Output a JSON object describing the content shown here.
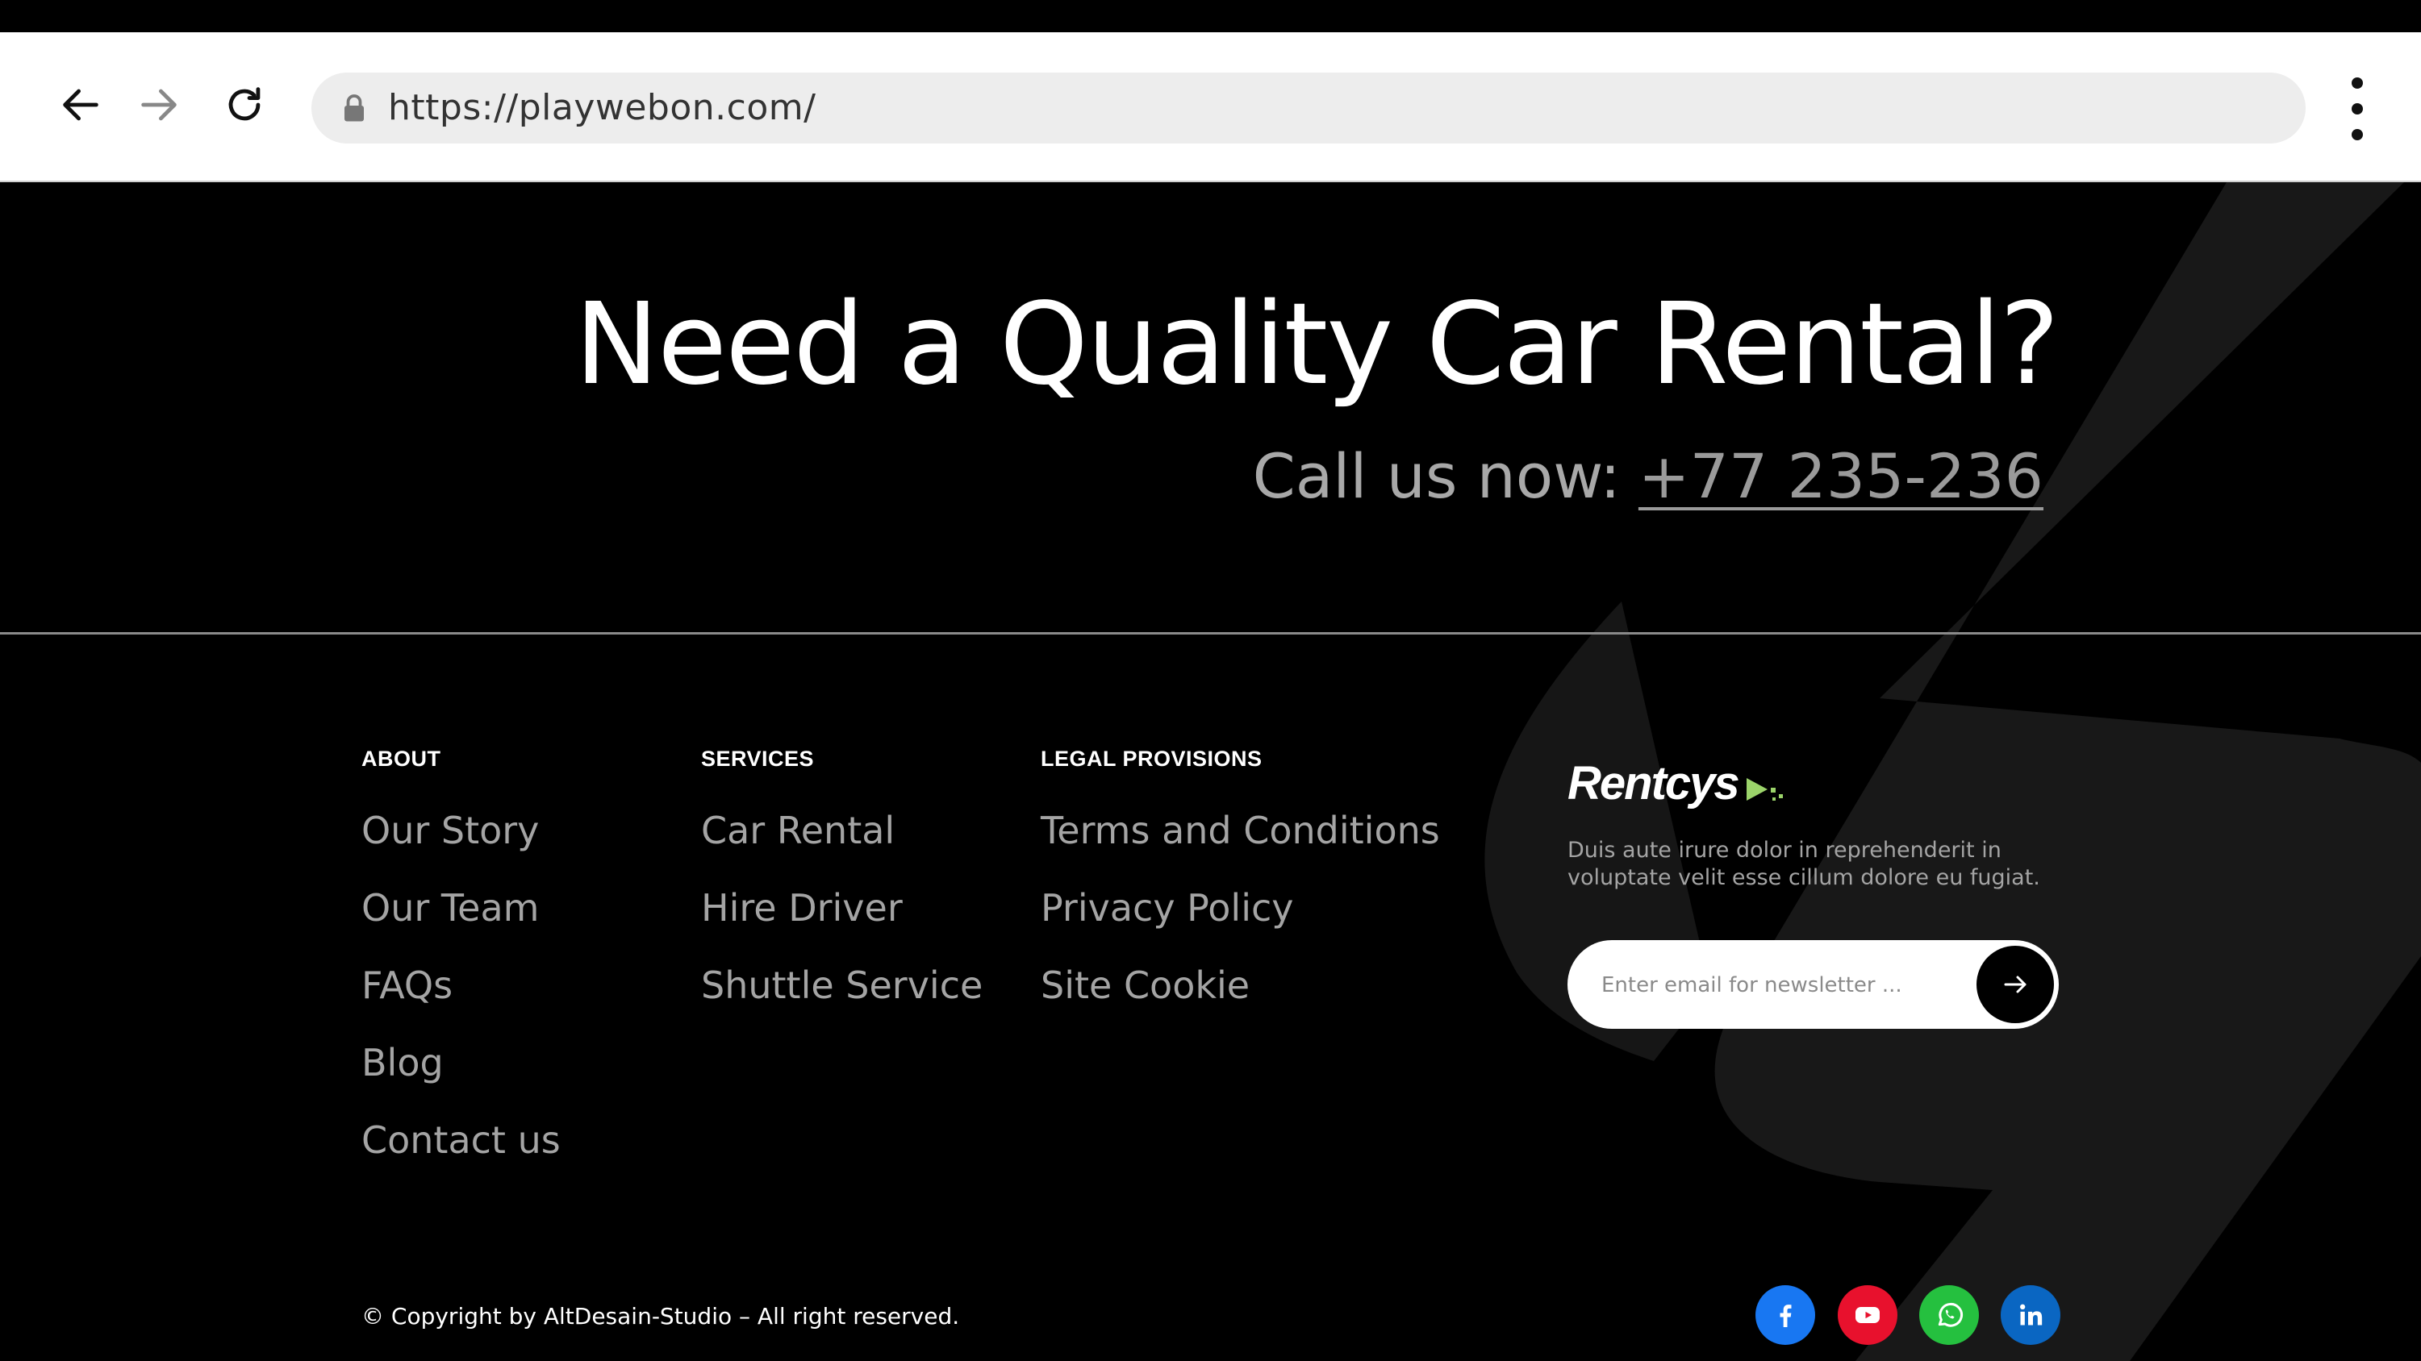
{
  "browser": {
    "url": "https://playwebon.com/"
  },
  "hero": {
    "title": "Need a Quality Car Rental?",
    "call_label": "Call us now:",
    "phone": "+77 235-236"
  },
  "footer": {
    "columns": [
      {
        "title": "ABOUT",
        "links": [
          "Our Story",
          "Our Team",
          "FAQs",
          "Blog",
          "Contact us"
        ]
      },
      {
        "title": "SERVICES",
        "links": [
          "Car Rental",
          "Hire Driver",
          "Shuttle Service"
        ]
      },
      {
        "title": "LEGAL PROVISIONS",
        "links": [
          "Terms and Conditions",
          "Privacy Policy",
          "Site Cookie"
        ]
      }
    ],
    "brand": {
      "name": "Rentcys",
      "accent_color": "#9bd36a",
      "description": "Duis aute irure dolor in reprehenderit in voluptate velit esse cillum dolore eu fugiat."
    },
    "newsletter": {
      "placeholder": "Enter email for newsletter ...",
      "value": ""
    },
    "copyright": "© Copyright by AltDesain-Studio – All right reserved.",
    "social": [
      {
        "icon": "facebook-icon",
        "color": "#1877f2"
      },
      {
        "icon": "youtube-icon",
        "color": "#e8112d"
      },
      {
        "icon": "whatsapp-icon",
        "color": "#25c03f"
      },
      {
        "icon": "linkedin-icon",
        "color": "#0a66c2"
      }
    ]
  }
}
